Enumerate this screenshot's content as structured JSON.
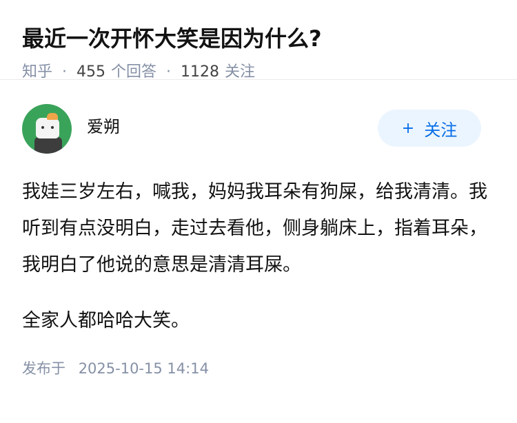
{
  "question": {
    "title": "最近一次开怀大笑是因为什么?",
    "source": "知乎",
    "answer_count": "455",
    "answer_label": "个回答",
    "follower_count": "1128",
    "follower_label": "关注"
  },
  "answer": {
    "author": {
      "name": "爱朔",
      "avatar_icon": "dog-avatar-icon"
    },
    "follow_button": {
      "icon": "+",
      "label": "关注"
    },
    "paragraphs": [
      "我娃三岁左右，喊我，妈妈我耳朵有狗屎，给我清清。我听到有点没明白，走过去看他，侧身躺床上，指着耳朵，我明白了他说的意思是清清耳屎。",
      "全家人都哈哈大笑。"
    ],
    "publish": {
      "label": "发布于",
      "datetime": "2025-10-15 14:14"
    }
  },
  "colors": {
    "accent": "#056de8",
    "button_bg": "#ebf5ff",
    "meta_gray": "#8590a6",
    "avatar_green": "#3aa35a"
  }
}
